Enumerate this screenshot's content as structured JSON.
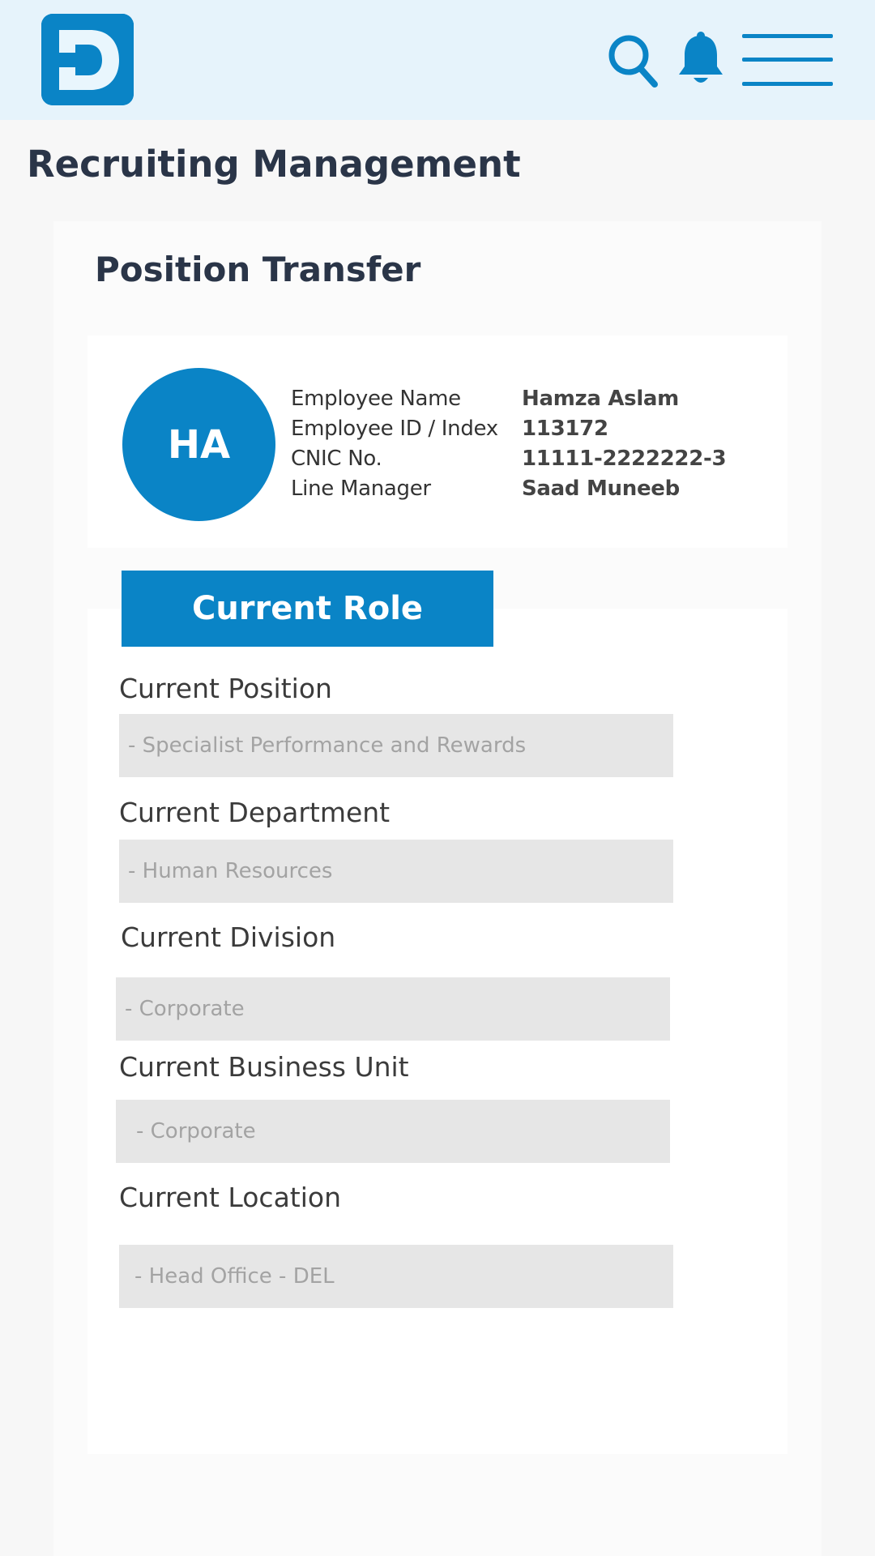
{
  "header": {
    "logo_letter": "D",
    "icons": {
      "search": "search-icon",
      "notifications": "bell-icon",
      "menu": "hamburger-menu-icon"
    }
  },
  "page": {
    "title": "Recruiting Management"
  },
  "card": {
    "title": "Position Transfer",
    "employee": {
      "initials": "HA",
      "fields": [
        {
          "label": "Employee Name",
          "value": "Hamza Aslam"
        },
        {
          "label": "Employee ID / Index",
          "value": "113172"
        },
        {
          "label": "CNIC No.",
          "value": "11111-2222222-3"
        },
        {
          "label": "Line Manager",
          "value": "Saad Muneeb"
        }
      ]
    },
    "current_role": {
      "tab_label": "Current Role",
      "fields": [
        {
          "label": "Current Position",
          "value": "- Specialist Performance and Rewards"
        },
        {
          "label": "Current Department",
          "value": "- Human Resources"
        },
        {
          "label": "Current Division",
          "value": "- Corporate"
        },
        {
          "label": "Current Business Unit",
          "value": "- Corporate"
        },
        {
          "label": "Current Location",
          "value": "- Head Office - DEL"
        }
      ]
    }
  },
  "colors": {
    "accent": "#0a84c6",
    "header_bg": "#e6f3fb",
    "title_text": "#2a3548",
    "field_bg": "#e6e6e6",
    "field_text": "#a3a3a3"
  }
}
